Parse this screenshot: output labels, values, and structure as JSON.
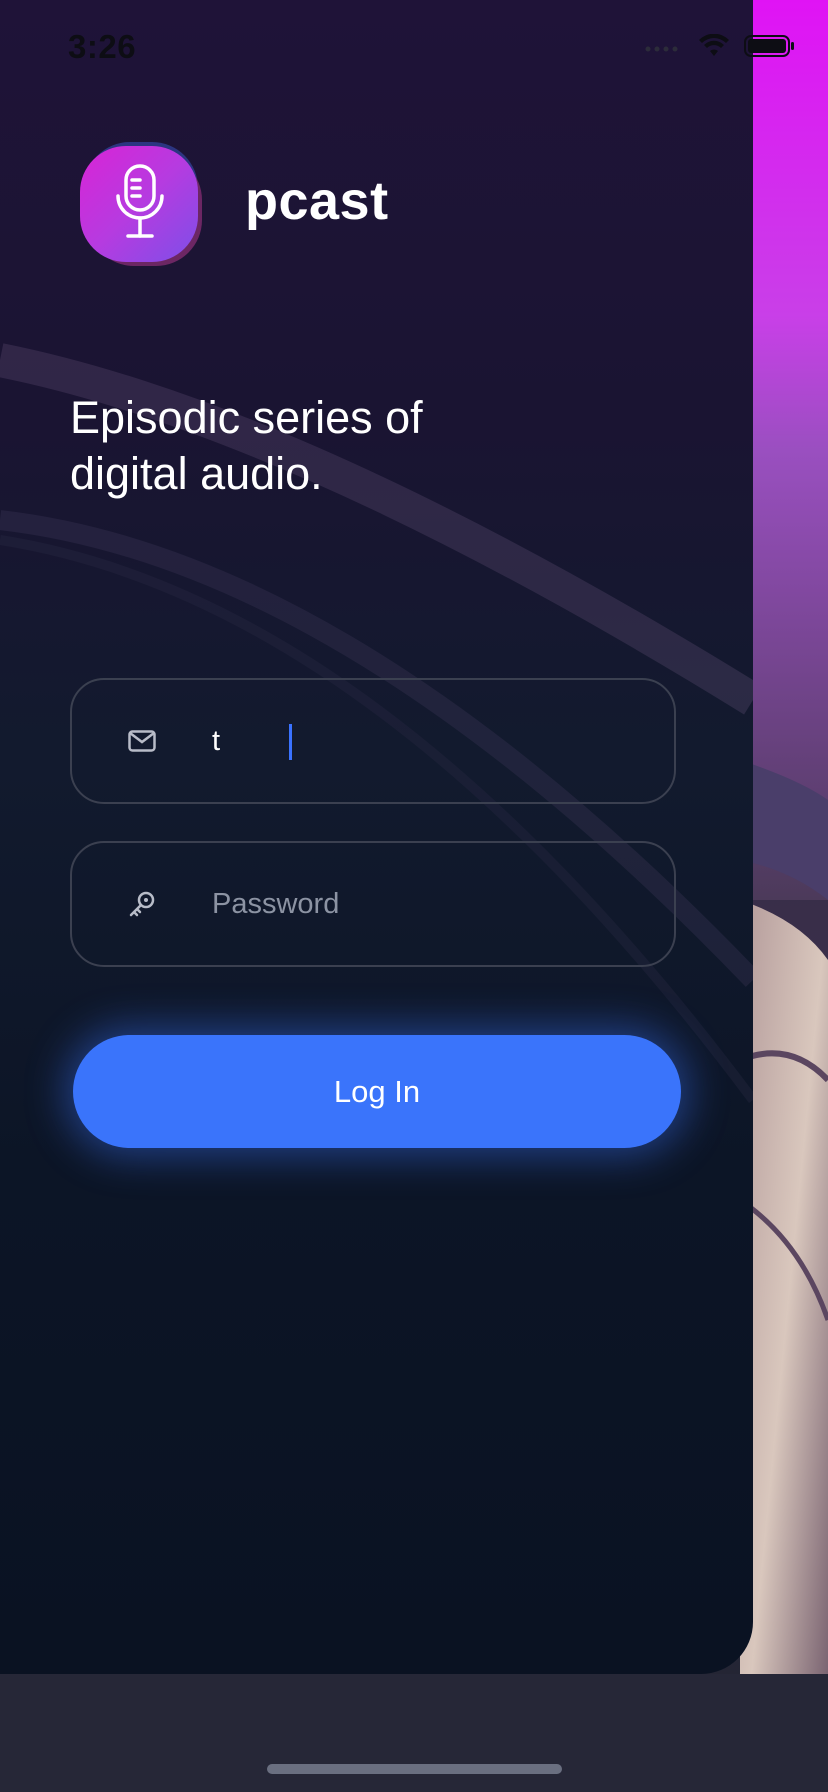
{
  "status_bar": {
    "time": "3:26",
    "icons": [
      "signal-icon",
      "wifi-icon",
      "battery-icon"
    ]
  },
  "brand": {
    "app_name": "pcast",
    "logo_icon": "microphone-icon"
  },
  "tagline": "Episodic series of digital audio.",
  "form": {
    "email": {
      "icon": "mail-icon",
      "value": "t",
      "placeholder": ""
    },
    "password": {
      "icon": "key-icon",
      "value": "",
      "placeholder": "Password"
    },
    "login_label": "Log In"
  },
  "colors": {
    "accent": "#3a74fb",
    "panel": "#121a2e",
    "brand_magenta": "#d42cf0"
  }
}
